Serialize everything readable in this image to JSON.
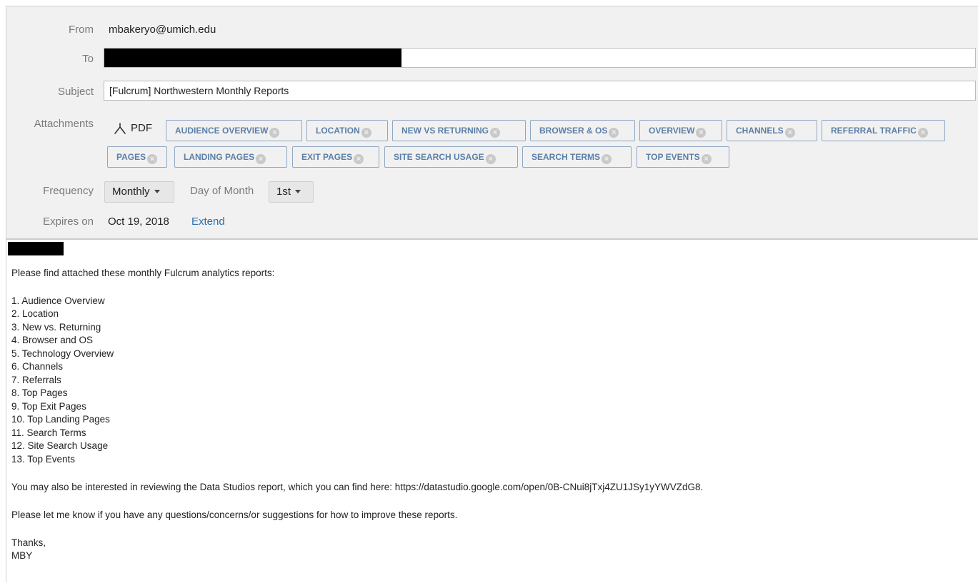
{
  "header": {
    "from_label": "From",
    "from_value": "mbakeryo@umich.edu",
    "to_label": "To",
    "subject_label": "Subject",
    "subject_value": "[Fulcrum] Northwestern Monthly Reports",
    "attachments_label": "Attachments",
    "format_label": "PDF",
    "attachments": [
      "AUDIENCE OVERVIEW",
      "LOCATION",
      "NEW VS RETURNING",
      "BROWSER & OS",
      "OVERVIEW",
      "CHANNELS",
      "REFERRAL TRAFFIC",
      "PAGES",
      "LANDING PAGES",
      "EXIT PAGES",
      "SITE SEARCH USAGE",
      "SEARCH TERMS",
      "TOP EVENTS"
    ],
    "frequency_label": "Frequency",
    "frequency_value": "Monthly",
    "day_of_month_label": "Day of Month",
    "day_of_month_value": "1st",
    "expires_label": "Expires on",
    "expires_value": "Oct 19, 2018",
    "extend_label": "Extend"
  },
  "body": {
    "intro": "Please find attached these monthly Fulcrum analytics reports:",
    "items": [
      "1. Audience Overview",
      "2. Location",
      "3. New vs. Returning",
      "4. Browser and OS",
      "5. Technology Overview",
      "6. Channels",
      "7. Referrals",
      "8. Top Pages",
      "9. Top Exit Pages",
      "10. Top Landing Pages",
      "11. Search Terms",
      "12. Site Search Usage",
      "13. Top Events"
    ],
    "data_studio_line": "You may also be interested in reviewing the Data Studios report, which you can find here: https://datastudio.google.com/open/0B-CNui8jTxj4ZU1JSy1yYWVZdG8.",
    "feedback_line": "Please let me know if you have any questions/concerns/or suggestions for how to improve these reports.",
    "closing": "Thanks,",
    "signature": "MBY"
  },
  "colors": {
    "header_bg": "#f1f1f1",
    "chip_text": "#5b7fa8",
    "chip_border": "#8fa7c4",
    "link": "#2a6fb0",
    "redaction": "#000000"
  },
  "icons": {
    "pdf": "pdf-icon",
    "remove_attachment": "close-circle-icon",
    "dropdown": "chevron-down-icon"
  }
}
